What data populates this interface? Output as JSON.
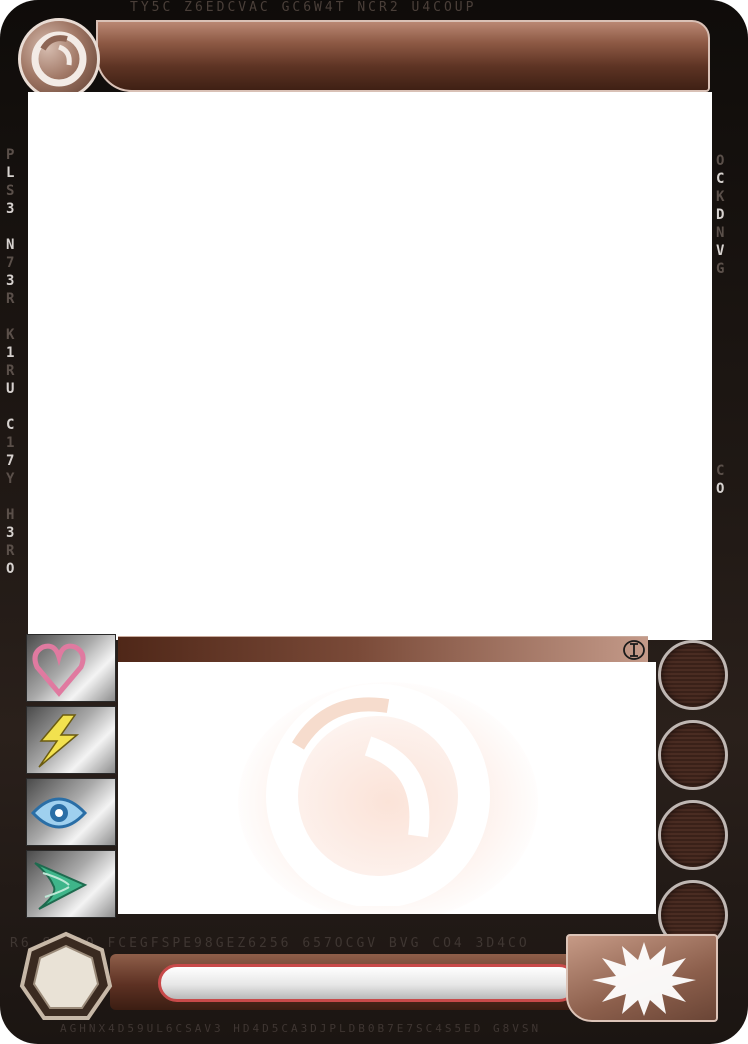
{
  "card": {
    "name": "",
    "effect_title": "",
    "effect_text": "",
    "bottom_text": "",
    "level": "",
    "power": ""
  },
  "stats": [
    {
      "icon": "heart-icon",
      "value": ""
    },
    {
      "icon": "lightning-icon",
      "value": ""
    },
    {
      "icon": "eye-icon",
      "value": ""
    },
    {
      "icon": "speed-arrow-icon",
      "value": ""
    }
  ],
  "energy_slots": [
    "",
    "",
    "",
    ""
  ],
  "decor": {
    "top_row": "TY5C Z6EDCVAC GC6W4T NCR2 U4COUP",
    "bottom_row_1": "R6 SCKDO FCEGFSPE98GEZ6256 657OCGV BVG CO4 3D4CO",
    "bottom_row_2": "AGHNX4D59UL6CSAV3 HD4D5CA3DJPLDB0B7E7SC4S5ED G8VSN",
    "left_column": [
      "P",
      "L",
      "S",
      "3",
      "",
      "N",
      "7",
      "3",
      "R",
      "",
      "K",
      "1",
      "R",
      "U",
      "",
      "C",
      "1",
      "7",
      "Y",
      "",
      "H",
      "3",
      "R",
      "O"
    ],
    "right_column": [
      "O",
      "C",
      "K",
      "D",
      "N",
      "V",
      "G"
    ],
    "right_column_2": [
      "C",
      "O"
    ]
  },
  "colors": {
    "frame": "#1f1814",
    "bar": "#7a4a38",
    "heart": "#e07aa0",
    "lightning": "#f2e14f",
    "eye": "#6aa8d8",
    "speed": "#3fb58a",
    "field_border": "#c84a4a"
  }
}
